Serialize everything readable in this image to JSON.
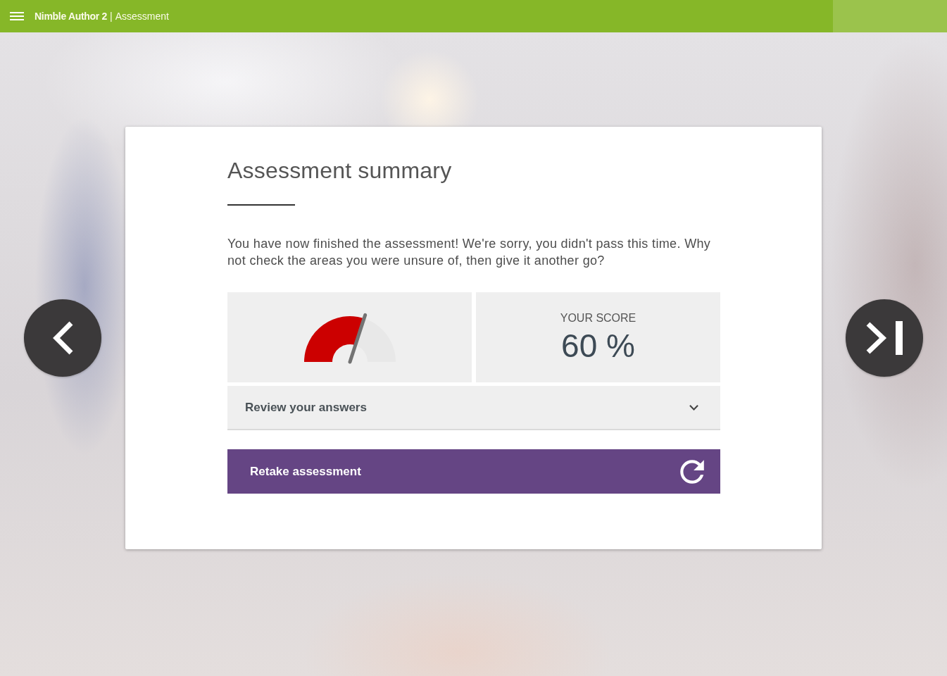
{
  "header": {
    "app_name": "Nimble Author 2",
    "separator": "|",
    "page_title": "Assessment"
  },
  "navigation": [
    {
      "kind": "previous"
    },
    {
      "kind": "last"
    }
  ],
  "summary": {
    "title": "Assessment summary",
    "message": "You have now finished the assessment! We're sorry, you didn't pass this time. Why not check the areas you were unsure of, then give it another go?",
    "score": {
      "gauge": {
        "level": 0.6
      },
      "label": "YOUR SCORE",
      "value": "60 %"
    },
    "review": {
      "label": "Review your answers",
      "expanded": false
    },
    "retake_button": {
      "label": "Retake assessment"
    }
  }
}
